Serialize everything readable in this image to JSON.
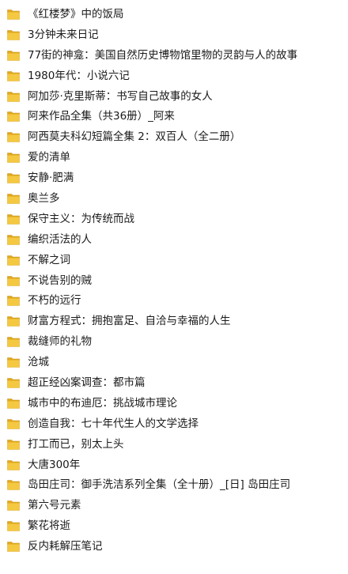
{
  "folder_icon": {
    "name": "folder-icon",
    "front_color": "#f5c842",
    "back_color": "#e0a81e",
    "edge_color": "#c9951a"
  },
  "folders": [
    {
      "name": "《红楼梦》中的饭局"
    },
    {
      "name": "3分钟未来日记"
    },
    {
      "name": "77街的神龛：美国自然历史博物馆里物的灵韵与人的故事"
    },
    {
      "name": "1980年代：小说六记"
    },
    {
      "name": "阿加莎·克里斯蒂：书写自己故事的女人"
    },
    {
      "name": "阿来作品全集（共36册）_阿来"
    },
    {
      "name": "阿西莫夫科幻短篇全集 2：双百人（全二册）"
    },
    {
      "name": "爱的清单"
    },
    {
      "name": "安静·肥满"
    },
    {
      "name": "奥兰多"
    },
    {
      "name": "保守主义：为传统而战"
    },
    {
      "name": "编织活法的人"
    },
    {
      "name": "不解之词"
    },
    {
      "name": "不说告别的贼"
    },
    {
      "name": "不朽的远行"
    },
    {
      "name": "财富方程式：拥抱富足、自洽与幸福的人生"
    },
    {
      "name": "裁缝师的礼物"
    },
    {
      "name": "沧城"
    },
    {
      "name": "超正经凶案调查：都市篇"
    },
    {
      "name": "城市中的布迪厄：挑战城市理论"
    },
    {
      "name": "创造自我：七十年代生人的文学选择"
    },
    {
      "name": "打工而已，别太上头"
    },
    {
      "name": "大唐300年"
    },
    {
      "name": "岛田庄司：御手洗洁系列全集（全十册）_[日] 岛田庄司"
    },
    {
      "name": "第六号元素"
    },
    {
      "name": "繁花将逝"
    },
    {
      "name": "反内耗解压笔记"
    }
  ]
}
